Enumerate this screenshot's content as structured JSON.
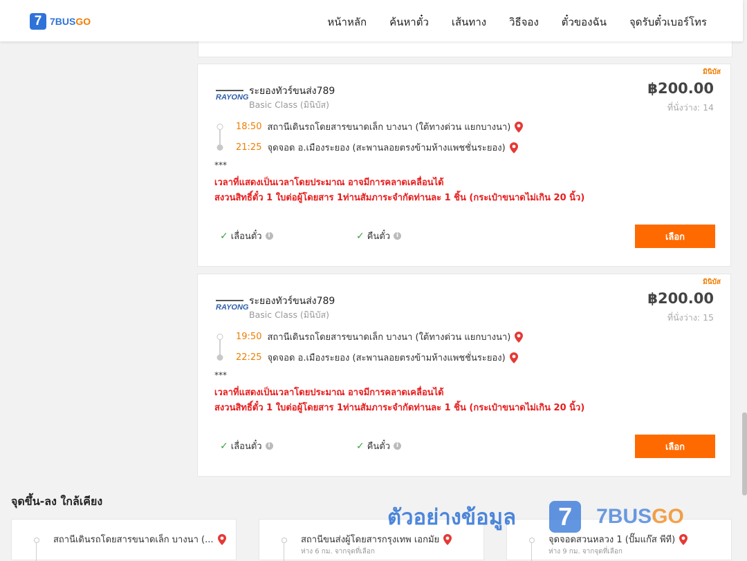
{
  "header": {
    "logo_mark": "7",
    "logo_text_a": "7BUS",
    "logo_text_b": "GO",
    "nav": [
      "หน้าหลัก",
      "ค้นหาตั๋ว",
      "เส้นทาง",
      "วิธีจอง",
      "ตั๋วของฉัน",
      "จุดรับตั๋วเบอร์โทร"
    ]
  },
  "colors": {
    "brand_blue": "#2f73d8",
    "brand_orange": "#f07d00",
    "button": "#ff6a00",
    "notice_red": "#e81c1c"
  },
  "trips": [
    {
      "badge": "มินิบัส",
      "operator_logo": "RAYONG",
      "operator": "ระยองทัวร์ขนส่ง789",
      "class": "Basic Class (มินิบัส)",
      "price": "฿200.00",
      "seats": "ที่นั่งว่าง: 14",
      "depart_time": "18:50",
      "depart_place": "สถานีเดินรถโดยสารขนาดเล็ก บางนา (ใต้ทางด่วน แยกบางนา)",
      "arrive_time": "21:25",
      "arrive_place": "จุดจอด อ.เมืองระยอง (สะพานลอยตรงข้ามห้างแพชชั่นระยอง)",
      "stars": "***",
      "notice1": "เวลาที่แสดงเป็นเวลาโดยประมาณ อาจมีการคลาดเคลื่อนได้",
      "notice2": "สงวนสิทธิ์ตั๋ว 1 ใบต่อผู้โดยสาร 1ท่านสัมภาระจำกัดท่านละ 1 ชิ้น (กระเป๋าขนาดไม่เกิน 20 นิ้ว)",
      "policy1": "เลื่อนตั๋ว",
      "policy2": "คืนตั๋ว",
      "select": "เลือก"
    },
    {
      "badge": "มินิบัส",
      "operator_logo": "RAYONG",
      "operator": "ระยองทัวร์ขนส่ง789",
      "class": "Basic Class (มินิบัส)",
      "price": "฿200.00",
      "seats": "ที่นั่งว่าง: 15",
      "depart_time": "19:50",
      "depart_place": "สถานีเดินรถโดยสารขนาดเล็ก บางนา (ใต้ทางด่วน แยกบางนา)",
      "arrive_time": "22:25",
      "arrive_place": "จุดจอด อ.เมืองระยอง (สะพานลอยตรงข้ามห้างแพชชั่นระยอง)",
      "stars": "***",
      "notice1": "เวลาที่แสดงเป็นเวลาโดยประมาณ อาจมีการคลาดเคลื่อนได้",
      "notice2": "สงวนสิทธิ์ตั๋ว 1 ใบต่อผู้โดยสาร 1ท่านสัมภาระจำกัดท่านละ 1 ชิ้น (กระเป๋าขนาดไม่เกิน 20 นิ้ว)",
      "policy1": "เลื่อนตั๋ว",
      "policy2": "คืนตั๋ว",
      "select": "เลือก"
    }
  ],
  "nearby": {
    "title": "จุดขึ้น-ลง ใกล้เคียง",
    "items": [
      {
        "name": "สถานีเดินรถโดยสารขนาดเล็ก บางนา (...",
        "distance": ""
      },
      {
        "name": "สถานีขนส่งผู้โดยสารกรุงเทพ เอกมัย",
        "distance": "ห่าง 6 กม. จากจุดที่เลือก"
      },
      {
        "name": "จุดจอดสวนหลวง 1 (ปั๊มแก๊ส พีที)",
        "distance": "ห่าง 9 กม. จากจุดที่เลือก"
      }
    ]
  },
  "watermark": {
    "text": "ตัวอย่างข้อมูล",
    "logo_mark": "7",
    "brand_a": "7BUS",
    "brand_b": "GO"
  }
}
